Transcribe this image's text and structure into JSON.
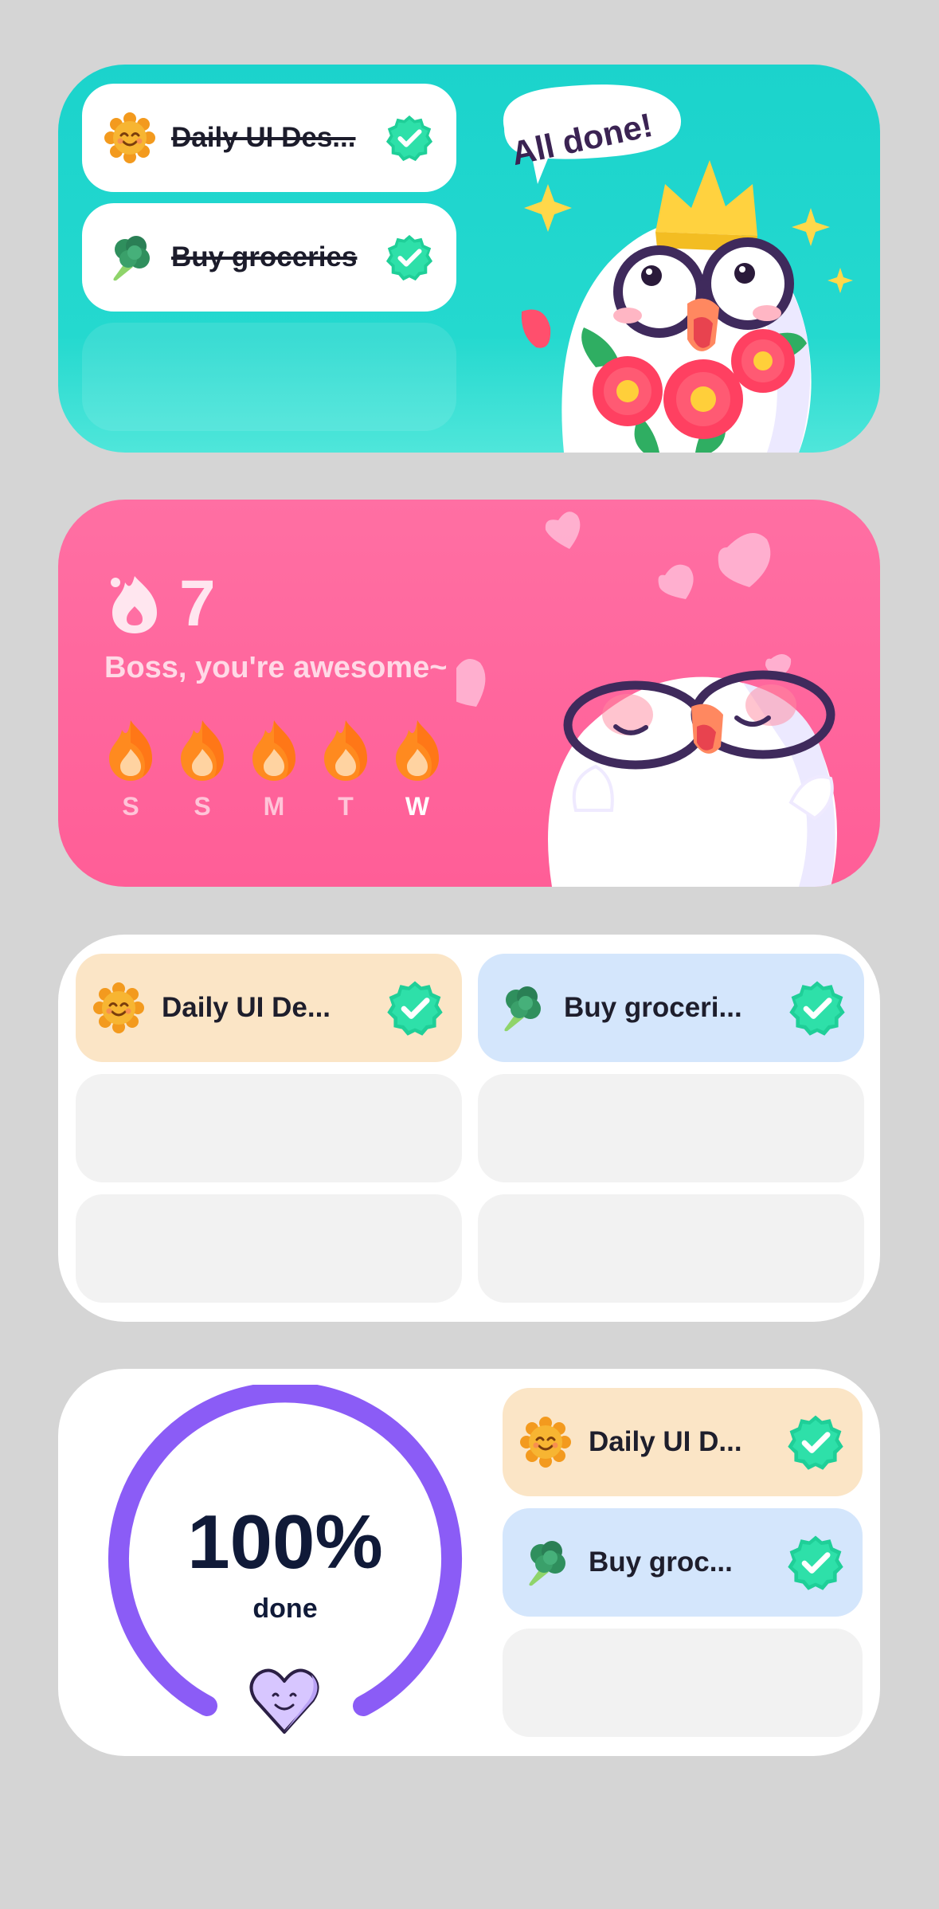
{
  "widget_todo_done": {
    "tasks": [
      {
        "label": "Daily UI Des...",
        "icon": "smiling-sun-icon",
        "done": true
      },
      {
        "label": "Buy groceries",
        "icon": "broccoli-icon",
        "done": true
      }
    ],
    "bubble_text": "All done!",
    "colors": {
      "background": "#1bd3cc"
    }
  },
  "widget_streak": {
    "streak_count": "7",
    "motto": "Boss, you're awesome~",
    "days": [
      {
        "label": "S",
        "today": false
      },
      {
        "label": "S",
        "today": false
      },
      {
        "label": "M",
        "today": false
      },
      {
        "label": "T",
        "today": false
      },
      {
        "label": "W",
        "today": true
      }
    ],
    "colors": {
      "background": "#ff6fa3",
      "flame": "#ff8a1f"
    }
  },
  "widget_grid": {
    "cells": [
      {
        "label": "Daily UI De...",
        "icon": "smiling-sun-icon",
        "done": true,
        "color": "#fbe5c6"
      },
      {
        "label": "Buy groceri...",
        "icon": "broccoli-icon",
        "done": true,
        "color": "#d4e6fc"
      },
      {
        "label": "",
        "empty": true
      },
      {
        "label": "",
        "empty": true
      },
      {
        "label": "",
        "empty": true
      },
      {
        "label": "",
        "empty": true
      }
    ]
  },
  "widget_progress": {
    "percent_text": "100%",
    "percent_value": 100,
    "sub_label": "done",
    "ring_color": "#8b5cf6",
    "tasks": [
      {
        "label": "Daily UI D...",
        "icon": "smiling-sun-icon",
        "done": true
      },
      {
        "label": "Buy groc...",
        "icon": "broccoli-icon",
        "done": true
      },
      {
        "label": "",
        "empty": true
      }
    ]
  }
}
